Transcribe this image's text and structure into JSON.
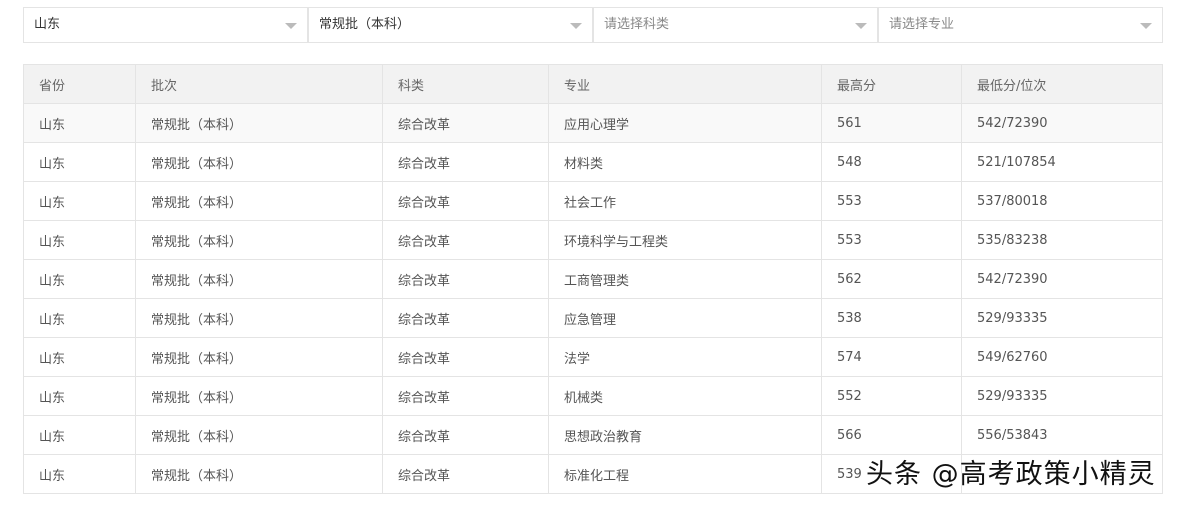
{
  "filters": [
    {
      "value": "山东",
      "placeholder": false
    },
    {
      "value": "常规批（本科）",
      "placeholder": false
    },
    {
      "value": "请选择科类",
      "placeholder": true
    },
    {
      "value": "请选择专业",
      "placeholder": true
    }
  ],
  "table": {
    "headers": [
      "省份",
      "批次",
      "科类",
      "专业",
      "最高分",
      "最低分/位次"
    ],
    "rows": [
      [
        "山东",
        "常规批（本科）",
        "综合改革",
        "应用心理学",
        "561",
        "542/72390"
      ],
      [
        "山东",
        "常规批（本科）",
        "综合改革",
        "材料类",
        "548",
        "521/107854"
      ],
      [
        "山东",
        "常规批（本科）",
        "综合改革",
        "社会工作",
        "553",
        "537/80018"
      ],
      [
        "山东",
        "常规批（本科）",
        "综合改革",
        "环境科学与工程类",
        "553",
        "535/83238"
      ],
      [
        "山东",
        "常规批（本科）",
        "综合改革",
        "工商管理类",
        "562",
        "542/72390"
      ],
      [
        "山东",
        "常规批（本科）",
        "综合改革",
        "应急管理",
        "538",
        "529/93335"
      ],
      [
        "山东",
        "常规批（本科）",
        "综合改革",
        "法学",
        "574",
        "549/62760"
      ],
      [
        "山东",
        "常规批（本科）",
        "综合改革",
        "机械类",
        "552",
        "529/93335"
      ],
      [
        "山东",
        "常规批（本科）",
        "综合改革",
        "思想政治教育",
        "566",
        "556/53843"
      ],
      [
        "山东",
        "常规批（本科）",
        "综合改革",
        "标准化工程",
        "539",
        ""
      ]
    ]
  },
  "watermark": "头条 @高考政策小精灵"
}
